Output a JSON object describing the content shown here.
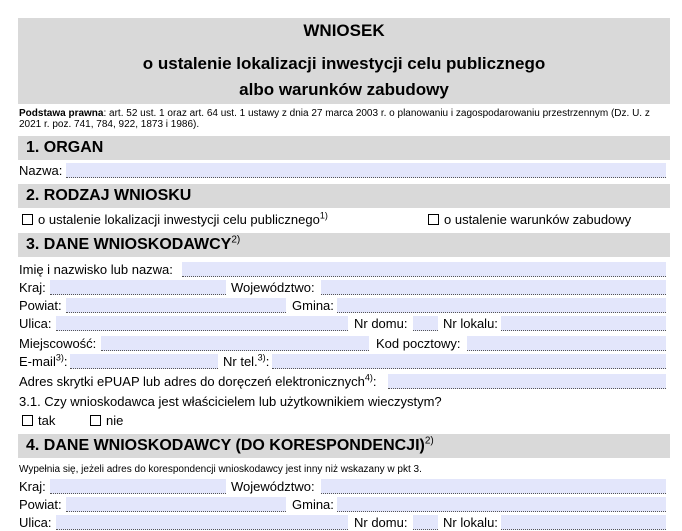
{
  "header": {
    "title": "WNIOSEK",
    "subtitle_line1": "o ustalenie lokalizacji inwestycji celu publicznego",
    "subtitle_line2": "albo warunków zabudowy"
  },
  "legal_basis": {
    "label": "Podstawa prawna",
    "text": ": art. 52 ust. 1 oraz art. 64 ust. 1 ustawy z dnia 27 marca 2003 r. o planowaniu i zagospodarowaniu przestrzennym (Dz. U. z 2021 r. poz. 741, 784, 922, 1873 i 1986)."
  },
  "section1": {
    "title": "1.  ORGAN",
    "name_label": "Nazwa:"
  },
  "section2": {
    "title": "2.  RODZAJ WNIOSKU",
    "option_a": "o ustalenie lokalizacji inwestycji celu publicznego",
    "option_a_note": "1)",
    "option_b": "o ustalenie warunków zabudowy"
  },
  "section3": {
    "title": "3.  DANE WNIOSKODAWCY",
    "title_note": "2)",
    "name_label": "Imię i nazwisko lub nazwa:",
    "country_label": "Kraj:",
    "voivodeship_label": "Województwo:",
    "county_label": "Powiat:",
    "commune_label": "Gmina:",
    "street_label": "Ulica:",
    "house_no_label": "Nr domu:",
    "apartment_no_label": "Nr lokalu:",
    "city_label": "Miejscowość:",
    "postal_code_label": "Kod pocztowy:",
    "email_label": "E-mail",
    "email_note": "3)",
    "phone_label": "Nr tel.",
    "phone_note": "3)",
    "epuap_label": "Adres skrytki ePUAP lub adres do doręczeń elektronicznych",
    "epuap_note": "4)",
    "question": "3.1.  Czy wnioskodawca jest właścicielem lub użytkownikiem wieczystym?",
    "yes": "tak",
    "no": "nie"
  },
  "section4": {
    "title": "4.  DANE WNIOSKODAWCY (DO KORESPONDENCJI)",
    "title_note": "2)",
    "hint": "Wypełnia się, jeżeli adres do korespondencji wnioskodawcy jest inny niż wskazany w pkt 3.",
    "country_label": "Kraj:",
    "voivodeship_label": "Województwo:",
    "county_label": "Powiat:",
    "commune_label": "Gmina:",
    "street_label": "Ulica:",
    "house_no_label": "Nr domu:",
    "apartment_no_label": "Nr lokalu:"
  }
}
